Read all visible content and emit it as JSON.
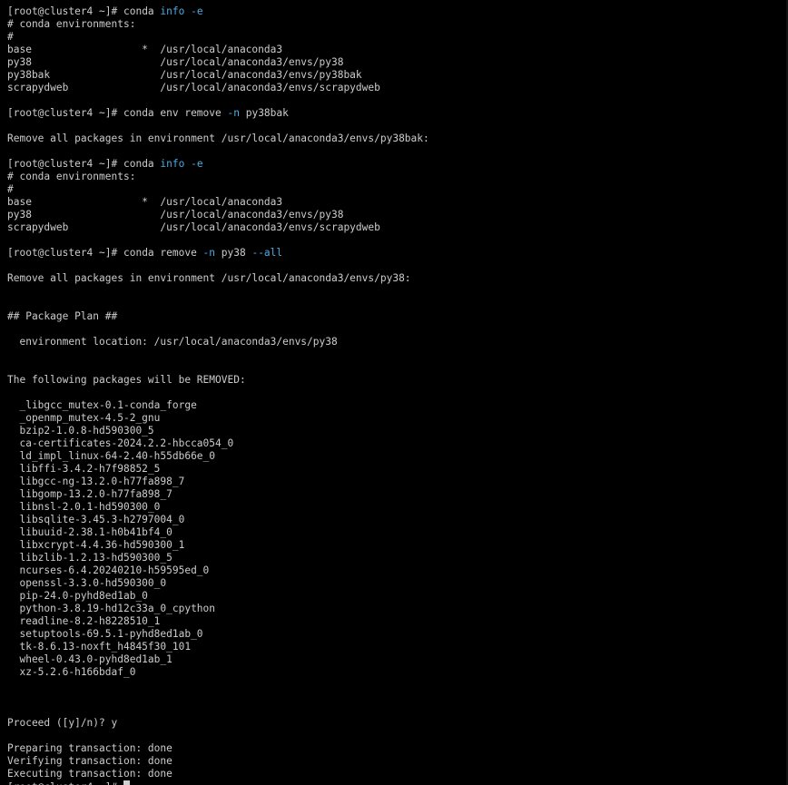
{
  "terminal": {
    "prompt": "[root@cluster4 ~]# ",
    "colors": {
      "background": "#000000",
      "text": "#cccccc",
      "keyword": "#4fa9e0",
      "cursor": "#d0d0d0"
    },
    "cmd1": {
      "a": "conda ",
      "b": "info",
      "c": " ",
      "d": "-e"
    },
    "env_header": "# conda environments:",
    "hash": "#",
    "env_list_1": [
      "base                  *  /usr/local/anaconda3",
      "py38                     /usr/local/anaconda3/envs/py38",
      "py38bak                  /usr/local/anaconda3/envs/py38bak",
      "scrapydweb               /usr/local/anaconda3/envs/scrapydweb"
    ],
    "cmd2": {
      "a": "conda env remove ",
      "b": "-n",
      "c": " py38bak"
    },
    "remove_msg_1": "Remove all packages in environment /usr/local/anaconda3/envs/py38bak:",
    "cmd3": {
      "a": "conda ",
      "b": "info",
      "c": " ",
      "d": "-e"
    },
    "env_list_2": [
      "base                  *  /usr/local/anaconda3",
      "py38                     /usr/local/anaconda3/envs/py38",
      "scrapydweb               /usr/local/anaconda3/envs/scrapydweb"
    ],
    "cmd4": {
      "a": "conda remove ",
      "b": "-n",
      "c": " py38 ",
      "d": "--all"
    },
    "remove_msg_2": "Remove all packages in environment /usr/local/anaconda3/envs/py38:",
    "package_plan": "## Package Plan ##",
    "env_location": "  environment location: /usr/local/anaconda3/envs/py38",
    "removed_header": "The following packages will be REMOVED:",
    "packages": [
      "  _libgcc_mutex-0.1-conda_forge",
      "  _openmp_mutex-4.5-2_gnu",
      "  bzip2-1.0.8-hd590300_5",
      "  ca-certificates-2024.2.2-hbcca054_0",
      "  ld_impl_linux-64-2.40-h55db66e_0",
      "  libffi-3.4.2-h7f98852_5",
      "  libgcc-ng-13.2.0-h77fa898_7",
      "  libgomp-13.2.0-h77fa898_7",
      "  libnsl-2.0.1-hd590300_0",
      "  libsqlite-3.45.3-h2797004_0",
      "  libuuid-2.38.1-h0b41bf4_0",
      "  libxcrypt-4.4.36-hd590300_1",
      "  libzlib-1.2.13-hd590300_5",
      "  ncurses-6.4.20240210-h59595ed_0",
      "  openssl-3.3.0-hd590300_0",
      "  pip-24.0-pyhd8ed1ab_0",
      "  python-3.8.19-hd12c33a_0_cpython",
      "  readline-8.2-h8228510_1",
      "  setuptools-69.5.1-pyhd8ed1ab_0",
      "  tk-8.6.13-noxft_h4845f30_101",
      "  wheel-0.43.0-pyhd8ed1ab_1",
      "  xz-5.2.6-h166bdaf_0"
    ],
    "proceed": "Proceed ([y]/n)? y",
    "status_lines": [
      "Preparing transaction: done",
      "Verifying transaction: done",
      "Executing transaction: done"
    ]
  }
}
